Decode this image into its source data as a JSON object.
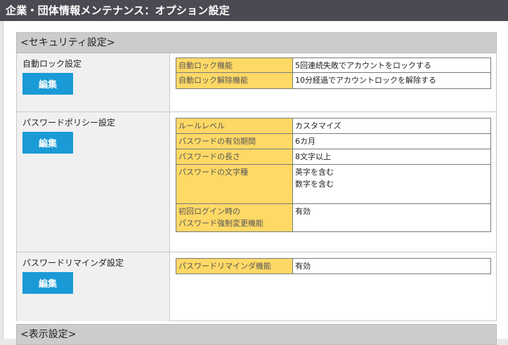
{
  "window": {
    "title": "企業・団体情報メンテナンス：オプション設定"
  },
  "sections": {
    "security": {
      "header": "<セキュリティ設定>",
      "rows": {
        "autolock": {
          "label": "自動ロック設定",
          "edit": "編集",
          "items": [
            {
              "key": "自動ロック機能",
              "value": "5回連続失敗でアカウントをロックする"
            },
            {
              "key": "自動ロック解除機能",
              "value": "10分経過でアカウントロックを解除する"
            }
          ]
        },
        "password_policy": {
          "label": "パスワードポリシー設定",
          "edit": "編集",
          "items": [
            {
              "key": "ルールレベル",
              "value": "カスタマイズ"
            },
            {
              "key": "パスワードの有効期間",
              "value": "6カ月"
            },
            {
              "key": "パスワードの長さ",
              "value": "8文字以上"
            },
            {
              "key": "パスワードの文字種",
              "values": [
                "英字を含む",
                "数字を含む"
              ]
            },
            {
              "keys": [
                "初回ログイン時の",
                "パスワード強制変更機能"
              ],
              "value": "有効"
            }
          ]
        },
        "reminder": {
          "label": "パスワードリマインダ設定",
          "edit": "編集",
          "items": [
            {
              "key": "パスワードリマインダ機能",
              "value": "有効"
            }
          ]
        }
      }
    },
    "display": {
      "header": "<表示設定>"
    }
  }
}
